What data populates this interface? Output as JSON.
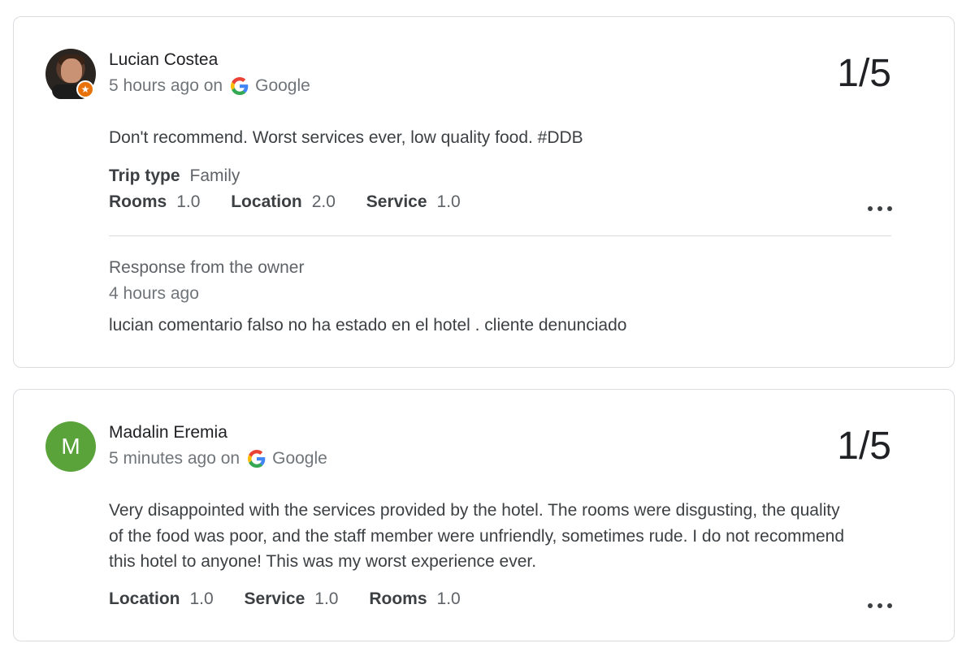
{
  "reviews": [
    {
      "reviewer": "Lucian Costea",
      "time": "5 hours ago on",
      "source": "Google",
      "score": "1/5",
      "text": "Don't recommend. Worst services ever, low quality food. #DDB",
      "trip_type_label": "Trip type",
      "trip_type_value": "Family",
      "ratings": [
        {
          "label": "Rooms",
          "value": "1.0"
        },
        {
          "label": "Location",
          "value": "2.0"
        },
        {
          "label": "Service",
          "value": "1.0"
        }
      ],
      "owner_response": {
        "label": "Response from the owner",
        "time": "4 hours ago",
        "text": "lucian comentario falso no ha estado en el hotel . cliente denunciado"
      },
      "avatar_icon": "local-guide-star-icon",
      "badge_color": "#e8710a"
    },
    {
      "reviewer": "Madalin Eremia",
      "time": "5 minutes ago on",
      "source": "Google",
      "score": "1/5",
      "avatar_letter": "M",
      "avatar_color": "#5aa33b",
      "text": "Very disappointed with the services provided by the hotel. The rooms were disgusting, the quality of the food was poor, and the staff member were unfriendly, sometimes rude. I do not recommend this hotel to anyone! This was my worst experience ever.",
      "ratings": [
        {
          "label": "Location",
          "value": "1.0"
        },
        {
          "label": "Service",
          "value": "1.0"
        },
        {
          "label": "Rooms",
          "value": "1.0"
        }
      ]
    }
  ]
}
